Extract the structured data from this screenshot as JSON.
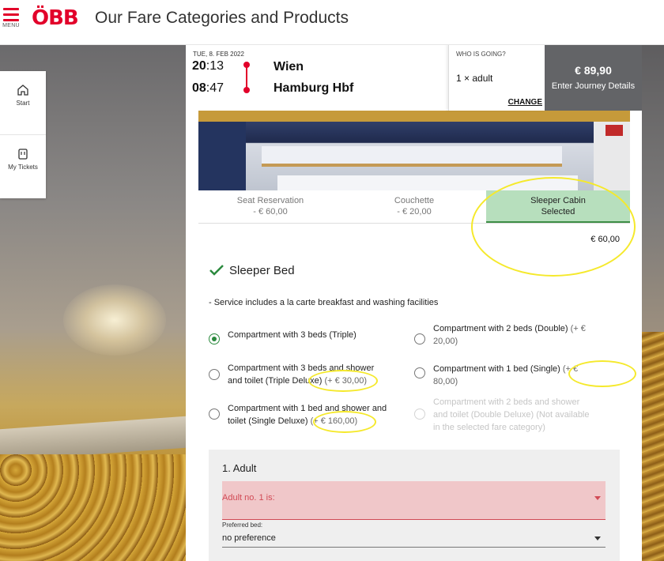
{
  "header": {
    "menu_label": "MENU",
    "logo": "ÖBB",
    "title": "Our Fare Categories and Products"
  },
  "sidenav": [
    {
      "label": "Start",
      "icon": "home-icon"
    },
    {
      "label": "My Tickets",
      "icon": "ticket-icon"
    }
  ],
  "journey": {
    "date": "TUE, 8. FEB 2022",
    "dep_hour": "20",
    "dep_min": ":13",
    "arr_hour": "08",
    "arr_min": ":47",
    "from": "Wien",
    "to": "Hamburg Hbf",
    "who_label": "WHO IS GOING?",
    "who_value": "1 × adult",
    "change": "CHANGE",
    "price": "€ 89,90",
    "details": "Enter Journey Details"
  },
  "tabs": [
    {
      "name": "Seat Reservation",
      "price": "- € 60,00"
    },
    {
      "name": "Couchette",
      "price": "- € 20,00"
    },
    {
      "name": "Sleeper Cabin",
      "price": "Selected"
    }
  ],
  "subtotal": "€ 60,00",
  "product": {
    "title": "Sleeper Bed",
    "service": "- Service includes a la carte breakfast and washing facilities"
  },
  "options": [
    {
      "label": "Compartment with 3 beds (Triple)",
      "extra": "",
      "selected": true
    },
    {
      "label": "Compartment with 2 beds (Double)",
      "extra": "(+ € 20,00)",
      "selected": false
    },
    {
      "label": "Compartment with 3 beds and shower and toilet (Triple Deluxe)",
      "extra": "(+ € 30,00)",
      "selected": false
    },
    {
      "label": "Compartment with 1 bed (Single)",
      "extra": "(+ € 80,00)",
      "selected": false
    },
    {
      "label": "Compartment with 1 bed and shower and toilet (Single Deluxe)",
      "extra": "(+ € 160,00)",
      "selected": false
    },
    {
      "label": "Compartment with 2 beds and shower and toilet (Double Deluxe) (Not available in the selected fare category)",
      "extra": "",
      "selected": false,
      "disabled": true
    }
  ],
  "adult": {
    "heading": "1. Adult",
    "select": "Adult no. 1 is:",
    "bed_label": "Preferred bed:",
    "bed_value": "no preference"
  },
  "colors": {
    "brand": "#e2002a",
    "selected_tab": "#b7dfbd",
    "check": "#2b8a3e",
    "highlight": "#f5e92c"
  }
}
